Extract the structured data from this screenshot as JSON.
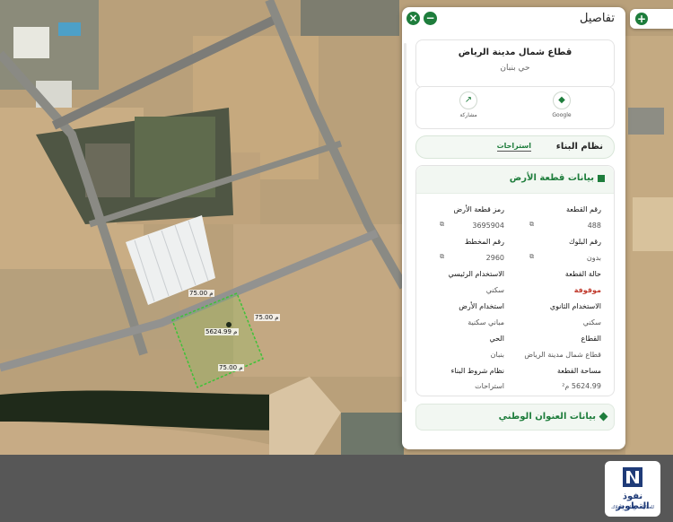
{
  "panel": {
    "title": "تفاصيل",
    "close_icon": "close-icon",
    "minimize_icon": "minimize-icon"
  },
  "parcel": {
    "title": "قطاع شمال مدينة الرياض",
    "subtitle": "حي بنبان"
  },
  "actions": {
    "share": "مشاركة",
    "google": "Google"
  },
  "building_plan": {
    "title": "نظام البناء",
    "tab": "استراحات"
  },
  "land_info": {
    "title": "بيانات قطعة الأرض",
    "fields": {
      "plot_no_label": "رقم القطعة",
      "plot_no_value": "488",
      "plot_code_label": "رمز قطعة الأرض",
      "plot_code_value": "3695904",
      "block_label": "رقم البلوك",
      "block_value": "بدون",
      "plan_label": "رقم المخطط",
      "plan_value": "2960",
      "status_label": "حالة القطعة",
      "status_value": "موقوفة",
      "main_use_label": "الاستخدام الرئيسي",
      "main_use_value": "سكني",
      "secondary_use_label": "الاستخدام الثانوي",
      "secondary_use_value": "سكني",
      "land_use_label": "استخدام الأرض",
      "land_use_value": "مباني سكنية",
      "sector_label": "القطاع",
      "sector_value": "قطاع شمال مدينة الرياض",
      "district_label": "الحي",
      "district_value": "بنبان",
      "area_label": "مساحة القطعة",
      "area_value": "5624.99 م²",
      "building_terms_label": "نظام شروط البناء",
      "building_terms_value": "استراحات"
    }
  },
  "address": {
    "title": "بيانات العنوان الوطني"
  },
  "map": {
    "plot_area_label": "5624.99 م",
    "edge_label_top": "75.00 م",
    "edge_label_right": "75.00 م",
    "edge_label_bottom": "75.00 م"
  },
  "logo": {
    "title": "نفوذ التطوير",
    "subtitle": "للعقارات وإدارة الأملاك"
  },
  "colors": {
    "accent": "#1e7d3c",
    "alert": "#c0392b"
  }
}
